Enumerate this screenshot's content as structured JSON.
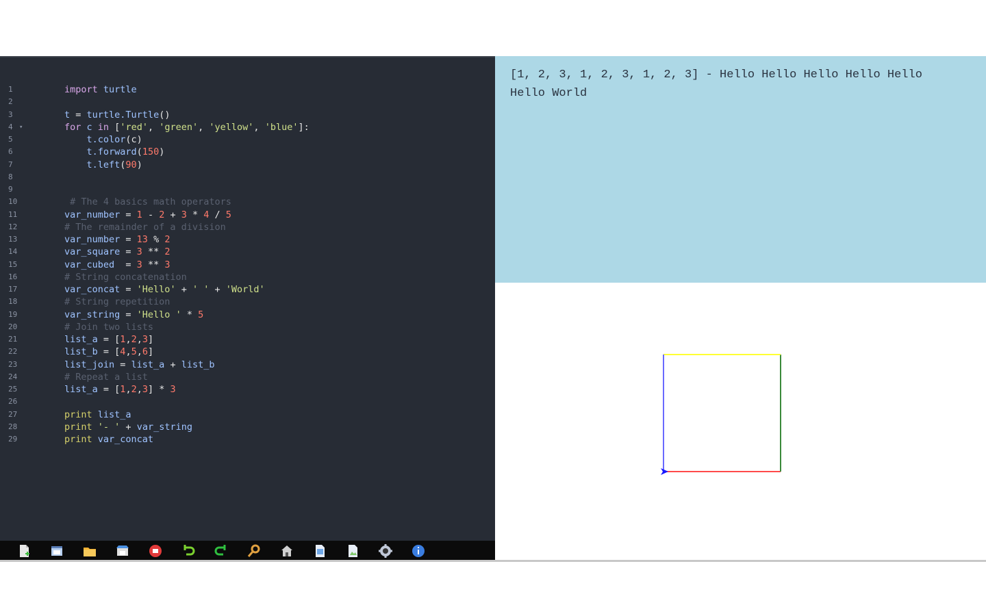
{
  "editor": {
    "lines": [
      {
        "n": "1",
        "fold": "",
        "tokens": [
          {
            "t": "import",
            "c": "kwp"
          },
          {
            "t": " turtle",
            "c": "id"
          }
        ]
      },
      {
        "n": "2",
        "fold": "",
        "tokens": []
      },
      {
        "n": "3",
        "fold": "",
        "tokens": [
          {
            "t": "t",
            "c": "id"
          },
          {
            "t": " = ",
            "c": "op"
          },
          {
            "t": "turtle.Turtle",
            "c": "id"
          },
          {
            "t": "()",
            "c": "op"
          }
        ]
      },
      {
        "n": "4",
        "fold": "▾",
        "tokens": [
          {
            "t": "for",
            "c": "kwp"
          },
          {
            "t": " c ",
            "c": "id"
          },
          {
            "t": "in",
            "c": "kwp"
          },
          {
            "t": " [",
            "c": "op"
          },
          {
            "t": "'red'",
            "c": "str"
          },
          {
            "t": ", ",
            "c": "op"
          },
          {
            "t": "'green'",
            "c": "str"
          },
          {
            "t": ", ",
            "c": "op"
          },
          {
            "t": "'yellow'",
            "c": "str"
          },
          {
            "t": ", ",
            "c": "op"
          },
          {
            "t": "'blue'",
            "c": "str"
          },
          {
            "t": "]:",
            "c": "op"
          }
        ]
      },
      {
        "n": "5",
        "fold": "",
        "tokens": [
          {
            "t": "    t.color",
            "c": "id"
          },
          {
            "t": "(c)",
            "c": "op"
          }
        ]
      },
      {
        "n": "6",
        "fold": "",
        "tokens": [
          {
            "t": "    t.forward",
            "c": "id"
          },
          {
            "t": "(",
            "c": "op"
          },
          {
            "t": "150",
            "c": "num"
          },
          {
            "t": ")",
            "c": "op"
          }
        ]
      },
      {
        "n": "7",
        "fold": "",
        "tokens": [
          {
            "t": "    t.left",
            "c": "id"
          },
          {
            "t": "(",
            "c": "op"
          },
          {
            "t": "90",
            "c": "num"
          },
          {
            "t": ")",
            "c": "op"
          }
        ]
      },
      {
        "n": "8",
        "fold": "",
        "tokens": []
      },
      {
        "n": "9",
        "fold": "",
        "tokens": []
      },
      {
        "n": "10",
        "fold": "",
        "tokens": [
          {
            "t": " # The 4 basics math operators",
            "c": "cm"
          }
        ]
      },
      {
        "n": "11",
        "fold": "",
        "tokens": [
          {
            "t": "var_number",
            "c": "id"
          },
          {
            "t": " = ",
            "c": "op"
          },
          {
            "t": "1",
            "c": "num"
          },
          {
            "t": " - ",
            "c": "op"
          },
          {
            "t": "2",
            "c": "num"
          },
          {
            "t": " + ",
            "c": "op"
          },
          {
            "t": "3",
            "c": "num"
          },
          {
            "t": " * ",
            "c": "op"
          },
          {
            "t": "4",
            "c": "num"
          },
          {
            "t": " / ",
            "c": "op"
          },
          {
            "t": "5",
            "c": "num"
          }
        ]
      },
      {
        "n": "12",
        "fold": "",
        "tokens": [
          {
            "t": "# The remainder of a division",
            "c": "cm"
          }
        ]
      },
      {
        "n": "13",
        "fold": "",
        "tokens": [
          {
            "t": "var_number",
            "c": "id"
          },
          {
            "t": " = ",
            "c": "op"
          },
          {
            "t": "13",
            "c": "num"
          },
          {
            "t": " % ",
            "c": "op"
          },
          {
            "t": "2",
            "c": "num"
          }
        ]
      },
      {
        "n": "14",
        "fold": "",
        "tokens": [
          {
            "t": "var_square",
            "c": "id"
          },
          {
            "t": " = ",
            "c": "op"
          },
          {
            "t": "3",
            "c": "num"
          },
          {
            "t": " ** ",
            "c": "op"
          },
          {
            "t": "2",
            "c": "num"
          }
        ]
      },
      {
        "n": "15",
        "fold": "",
        "tokens": [
          {
            "t": "var_cubed",
            "c": "id"
          },
          {
            "t": "  = ",
            "c": "op"
          },
          {
            "t": "3",
            "c": "num"
          },
          {
            "t": " ** ",
            "c": "op"
          },
          {
            "t": "3",
            "c": "num"
          }
        ]
      },
      {
        "n": "16",
        "fold": "",
        "tokens": [
          {
            "t": "# String concatenation",
            "c": "cm"
          }
        ]
      },
      {
        "n": "17",
        "fold": "",
        "tokens": [
          {
            "t": "var_concat",
            "c": "id"
          },
          {
            "t": " = ",
            "c": "op"
          },
          {
            "t": "'Hello'",
            "c": "str"
          },
          {
            "t": " + ",
            "c": "op"
          },
          {
            "t": "' '",
            "c": "str"
          },
          {
            "t": " + ",
            "c": "op"
          },
          {
            "t": "'World'",
            "c": "str"
          }
        ]
      },
      {
        "n": "18",
        "fold": "",
        "tokens": [
          {
            "t": "# String repetition",
            "c": "cm"
          }
        ]
      },
      {
        "n": "19",
        "fold": "",
        "tokens": [
          {
            "t": "var_string",
            "c": "id"
          },
          {
            "t": " = ",
            "c": "op"
          },
          {
            "t": "'Hello '",
            "c": "str"
          },
          {
            "t": " * ",
            "c": "op"
          },
          {
            "t": "5",
            "c": "num"
          }
        ]
      },
      {
        "n": "20",
        "fold": "",
        "tokens": [
          {
            "t": "# Join two lists",
            "c": "cm"
          }
        ]
      },
      {
        "n": "21",
        "fold": "",
        "tokens": [
          {
            "t": "list_a",
            "c": "id"
          },
          {
            "t": " = [",
            "c": "op"
          },
          {
            "t": "1",
            "c": "num"
          },
          {
            "t": ",",
            "c": "op"
          },
          {
            "t": "2",
            "c": "num"
          },
          {
            "t": ",",
            "c": "op"
          },
          {
            "t": "3",
            "c": "num"
          },
          {
            "t": "]",
            "c": "op"
          }
        ]
      },
      {
        "n": "22",
        "fold": "",
        "tokens": [
          {
            "t": "list_b",
            "c": "id"
          },
          {
            "t": " = [",
            "c": "op"
          },
          {
            "t": "4",
            "c": "num"
          },
          {
            "t": ",",
            "c": "op"
          },
          {
            "t": "5",
            "c": "num"
          },
          {
            "t": ",",
            "c": "op"
          },
          {
            "t": "6",
            "c": "num"
          },
          {
            "t": "]",
            "c": "op"
          }
        ]
      },
      {
        "n": "23",
        "fold": "",
        "tokens": [
          {
            "t": "list_join",
            "c": "id"
          },
          {
            "t": " = ",
            "c": "op"
          },
          {
            "t": "list_a",
            "c": "id"
          },
          {
            "t": " + ",
            "c": "op"
          },
          {
            "t": "list_b",
            "c": "id"
          }
        ]
      },
      {
        "n": "24",
        "fold": "",
        "tokens": [
          {
            "t": "# Repeat a list",
            "c": "cm"
          }
        ]
      },
      {
        "n": "25",
        "fold": "",
        "tokens": [
          {
            "t": "list_a",
            "c": "id"
          },
          {
            "t": " = [",
            "c": "op"
          },
          {
            "t": "1",
            "c": "num"
          },
          {
            "t": ",",
            "c": "op"
          },
          {
            "t": "2",
            "c": "num"
          },
          {
            "t": ",",
            "c": "op"
          },
          {
            "t": "3",
            "c": "num"
          },
          {
            "t": "] * ",
            "c": "op"
          },
          {
            "t": "3",
            "c": "num"
          }
        ]
      },
      {
        "n": "26",
        "fold": "",
        "tokens": []
      },
      {
        "n": "27",
        "fold": "",
        "tokens": [
          {
            "t": "print",
            "c": "kw"
          },
          {
            "t": " list_a",
            "c": "id"
          }
        ]
      },
      {
        "n": "28",
        "fold": "",
        "tokens": [
          {
            "t": "print",
            "c": "kw"
          },
          {
            "t": " ",
            "c": "op"
          },
          {
            "t": "'- '",
            "c": "str"
          },
          {
            "t": " + ",
            "c": "op"
          },
          {
            "t": "var_string",
            "c": "id"
          }
        ]
      },
      {
        "n": "29",
        "fold": "",
        "tokens": [
          {
            "t": "print",
            "c": "kw"
          },
          {
            "t": " var_concat",
            "c": "id"
          }
        ]
      }
    ]
  },
  "toolbar": {
    "buttons": [
      {
        "name": "new-file-icon",
        "color": "#e8e8e8"
      },
      {
        "name": "open-file-icon",
        "color": "#b8d0f0"
      },
      {
        "name": "folder-icon",
        "color": "#f2b233"
      },
      {
        "name": "save-icon",
        "color": "#4a90e2"
      },
      {
        "name": "run-icon",
        "color": "#e23a3a"
      },
      {
        "name": "undo-icon",
        "color": "#7bd12f"
      },
      {
        "name": "redo-icon",
        "color": "#2fbf3f"
      },
      {
        "name": "search-icon",
        "color": "#e0a040"
      },
      {
        "name": "home-icon",
        "color": "#d0d0d0"
      },
      {
        "name": "export-icon",
        "color": "#6fa8e8"
      },
      {
        "name": "image-icon",
        "color": "#7fc86a"
      },
      {
        "name": "settings-icon",
        "color": "#c0c8d8"
      },
      {
        "name": "info-icon",
        "color": "#3a7de0"
      }
    ]
  },
  "output": {
    "text": "[1, 2, 3, 1, 2, 3, 1, 2, 3] - Hello Hello Hello Hello Hello\nHello World"
  },
  "turtle": {
    "step": 150,
    "turn": 90,
    "colors": [
      "red",
      "green",
      "yellow",
      "blue"
    ],
    "heading_color": "blue"
  }
}
